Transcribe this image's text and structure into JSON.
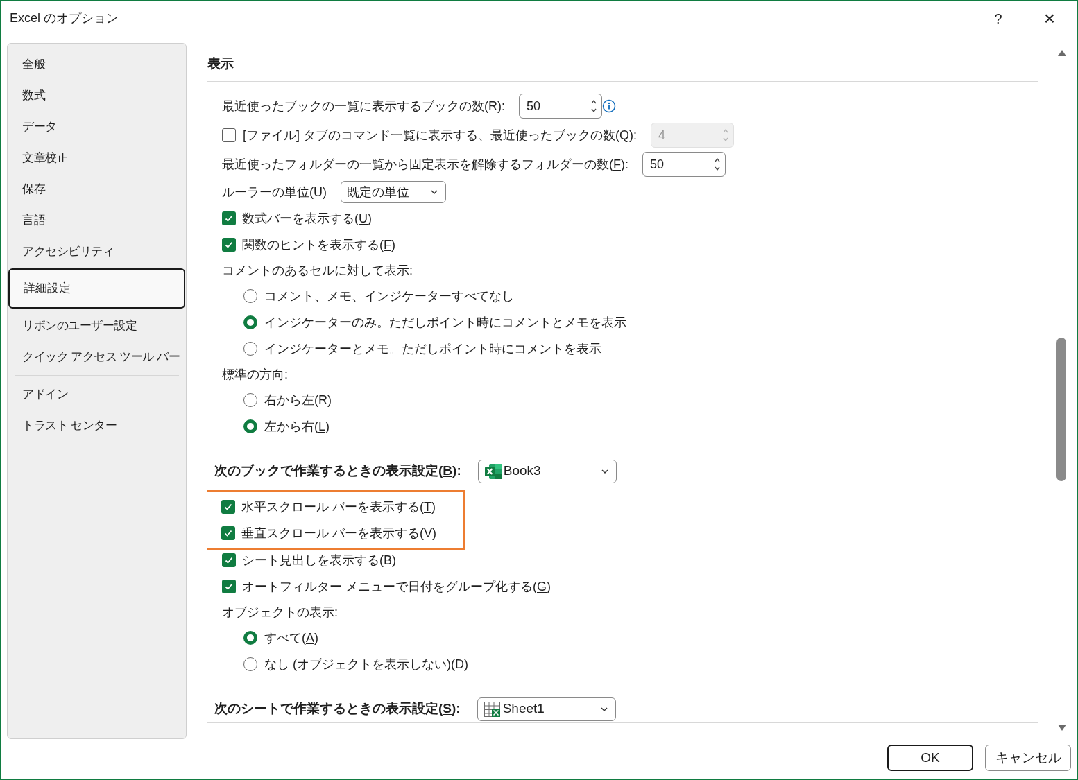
{
  "window": {
    "title": "Excel のオプション",
    "help_button": "?",
    "close_button": "×"
  },
  "sidebar": {
    "groups": [
      [
        {
          "label": "全般",
          "selected": false
        },
        {
          "label": "数式",
          "selected": false
        },
        {
          "label": "データ",
          "selected": false
        },
        {
          "label": "文章校正",
          "selected": false
        },
        {
          "label": "保存",
          "selected": false
        },
        {
          "label": "言語",
          "selected": false
        },
        {
          "label": "アクセシビリティ",
          "selected": false
        },
        {
          "label": "詳細設定",
          "selected": true
        },
        {
          "label": "リボンのユーザー設定",
          "selected": false
        },
        {
          "label": "クイック アクセス ツール バー",
          "selected": false
        }
      ],
      [
        {
          "label": "アドイン",
          "selected": false
        },
        {
          "label": "トラスト センター",
          "selected": false
        }
      ]
    ]
  },
  "content": {
    "items": [
      {
        "kind": "heading",
        "label": "表示"
      },
      {
        "kind": "spin",
        "label": "最近使ったブックの一覧に表示するブックの数(R):",
        "value": "50",
        "disabled": false,
        "info": true
      },
      {
        "kind": "check_spin",
        "label": "[ファイル] タブのコマンド一覧に表示する、最近使ったブックの数(Q):",
        "checked": false,
        "value": "4",
        "disabled": true
      },
      {
        "kind": "spin",
        "label": "最近使ったフォルダーの一覧から固定表示を解除するフォルダーの数(F):",
        "value": "50",
        "disabled": false,
        "info": false
      },
      {
        "kind": "select",
        "label": "ルーラーの単位(U)",
        "value": "既定の単位"
      },
      {
        "kind": "checkbox",
        "label": "数式バーを表示する(U)",
        "checked": true,
        "highlighted": false
      },
      {
        "kind": "checkbox",
        "label": "関数のヒントを表示する(F)",
        "checked": true,
        "highlighted": false
      },
      {
        "kind": "label",
        "label": "コメントのあるセルに対して表示:"
      },
      {
        "kind": "radio_group",
        "options": [
          {
            "label": "コメント、メモ、インジケーターすべてなし",
            "selected": false
          },
          {
            "label": "インジケーターのみ。ただしポイント時にコメントとメモを表示",
            "selected": true
          },
          {
            "label": "インジケーターとメモ。ただしポイント時にコメントを表示",
            "selected": false
          }
        ]
      },
      {
        "kind": "label",
        "label": "標準の方向:"
      },
      {
        "kind": "radio_group",
        "options": [
          {
            "label": "右から左(R)",
            "selected": false
          },
          {
            "label": "左から右(L)",
            "selected": true
          }
        ]
      },
      {
        "kind": "section",
        "label": "次のブックで作業するときの表示設定(B):",
        "value": "Book3"
      },
      {
        "kind": "checkbox",
        "label": "水平スクロール バーを表示する(T)",
        "checked": true,
        "highlighted": true
      },
      {
        "kind": "checkbox",
        "label": "垂直スクロール バーを表示する(V)",
        "checked": true,
        "highlighted": true
      },
      {
        "kind": "checkbox",
        "label": "シート見出しを表示する(B)",
        "checked": true,
        "highlighted": false
      },
      {
        "kind": "checkbox",
        "label": "オートフィルター メニューで日付をグループ化する(G)",
        "checked": true,
        "highlighted": false
      },
      {
        "kind": "label",
        "label": "オブジェクトの表示:"
      },
      {
        "kind": "radio_group",
        "options": [
          {
            "label": "すべて(A)",
            "selected": true
          },
          {
            "label": "なし (オブジェクトを表示しない)(D)",
            "selected": false
          }
        ]
      },
      {
        "kind": "section",
        "label": "次のシートで作業するときの表示設定(S):",
        "value": "Sheet1"
      }
    ]
  },
  "buttons": [
    {
      "label": "OK",
      "default": true
    },
    {
      "label": "キャンセル",
      "default": false
    }
  ]
}
